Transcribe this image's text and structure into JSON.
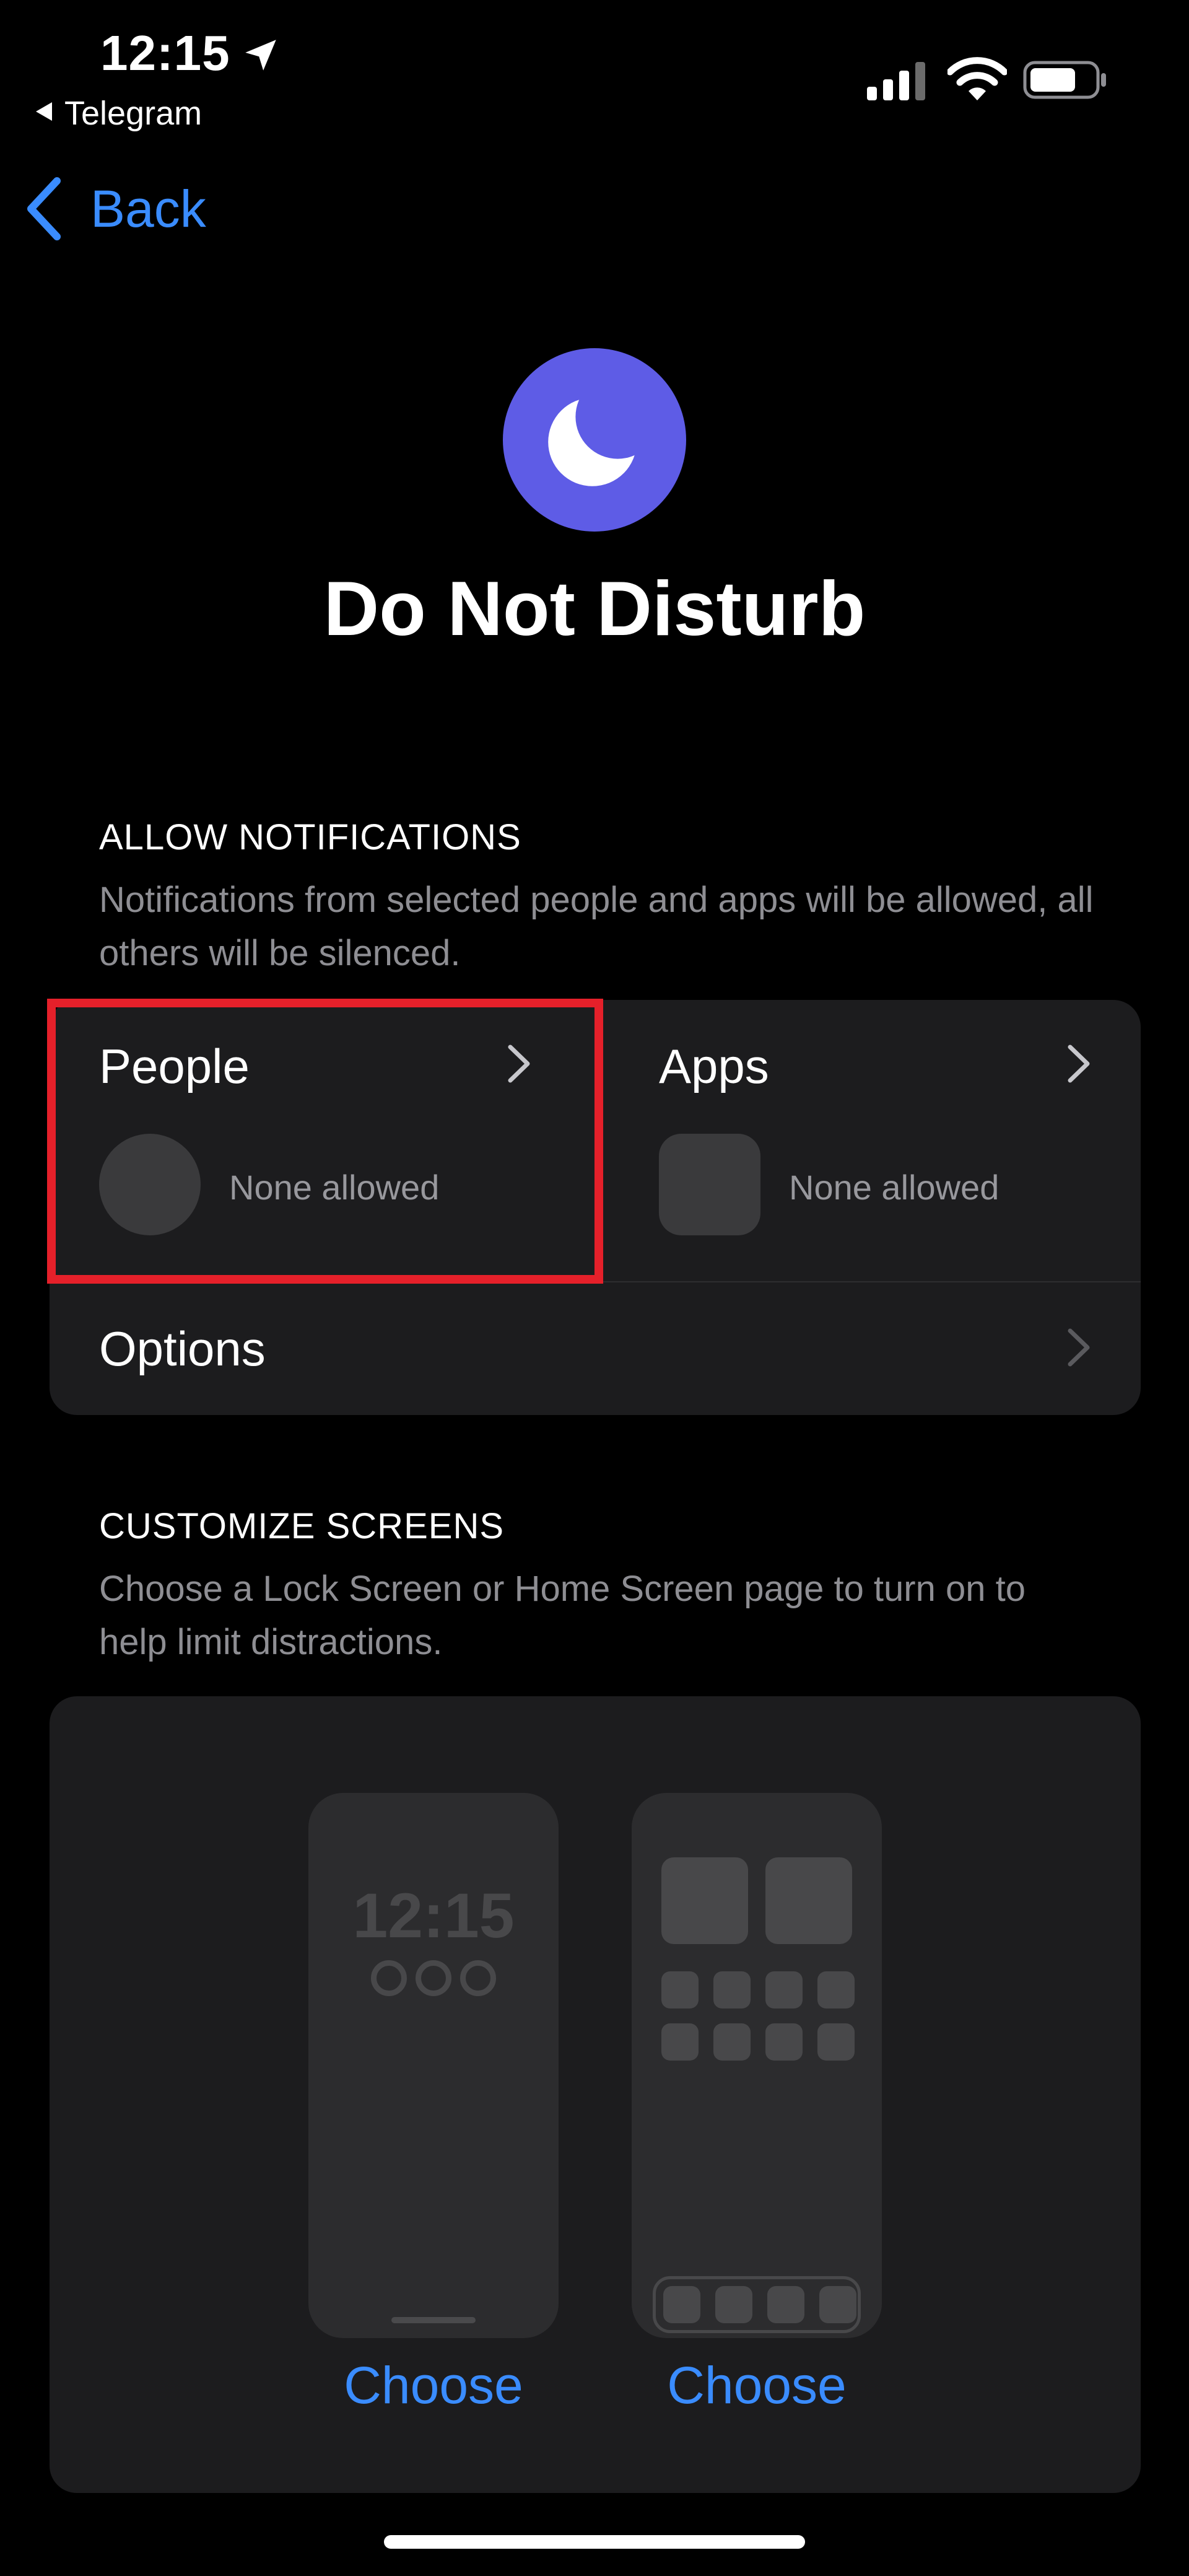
{
  "status_bar": {
    "time": "12:15",
    "back_app": "Telegram",
    "icons": [
      "location-arrow-icon",
      "cellular-signal-icon",
      "wifi-icon",
      "battery-icon"
    ]
  },
  "nav": {
    "back_label": "Back",
    "icon": "chevron-left-icon"
  },
  "header": {
    "icon": "moon-icon",
    "title": "Do Not Disturb"
  },
  "allow_notifications": {
    "heading": "ALLOW NOTIFICATIONS",
    "description": "Notifications from selected people and apps will be allowed, all others will be silenced.",
    "people": {
      "label": "People",
      "status": "None allowed"
    },
    "apps": {
      "label": "Apps",
      "status": "None allowed"
    },
    "options": {
      "label": "Options"
    }
  },
  "customize_screens": {
    "heading": "CUSTOMIZE SCREENS",
    "description": "Choose a Lock Screen or Home Screen page to turn on to help limit distractions.",
    "lock_screen": {
      "preview_time": "12:15",
      "choose_label": "Choose"
    },
    "home_screen": {
      "choose_label": "Choose"
    }
  },
  "colors": {
    "accent": "#3a8cff",
    "focus_purple": "#5e5ce6",
    "highlight_red": "#e5202a"
  }
}
